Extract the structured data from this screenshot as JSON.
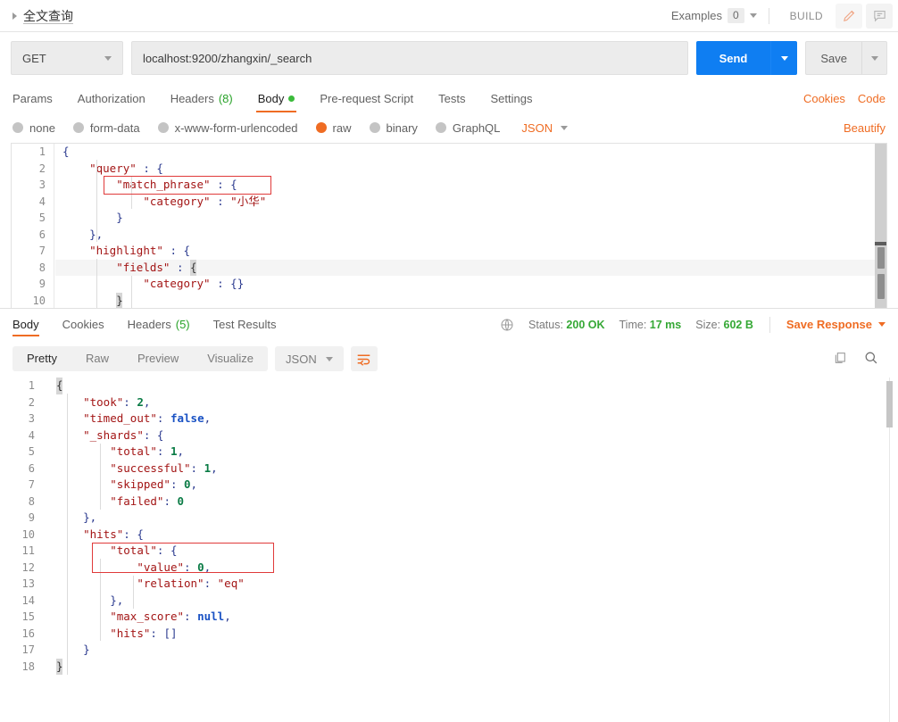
{
  "titlebar": {
    "breadcrumb": "全文查询",
    "examples_label": "Examples",
    "examples_count": "0",
    "build_label": "BUILD",
    "edit_icon": "pencil-icon",
    "comment_icon": "comment-icon"
  },
  "urlbar": {
    "method": "GET",
    "url": "localhost:9200/zhangxin/_search",
    "send_label": "Send",
    "save_label": "Save"
  },
  "request_tabs": {
    "items": [
      {
        "label": "Params",
        "count": "",
        "active": false,
        "dot": false
      },
      {
        "label": "Authorization",
        "count": "",
        "active": false,
        "dot": false
      },
      {
        "label": "Headers",
        "count": "(8)",
        "active": false,
        "dot": false
      },
      {
        "label": "Body",
        "count": "",
        "active": true,
        "dot": true
      },
      {
        "label": "Pre-request Script",
        "count": "",
        "active": false,
        "dot": false
      },
      {
        "label": "Tests",
        "count": "",
        "active": false,
        "dot": false
      },
      {
        "label": "Settings",
        "count": "",
        "active": false,
        "dot": false
      }
    ],
    "cookies_label": "Cookies",
    "code_label": "Code"
  },
  "body_row": {
    "options": [
      {
        "label": "none",
        "selected": false
      },
      {
        "label": "form-data",
        "selected": false
      },
      {
        "label": "x-www-form-urlencoded",
        "selected": false
      },
      {
        "label": "raw",
        "selected": true
      },
      {
        "label": "binary",
        "selected": false
      },
      {
        "label": "GraphQL",
        "selected": false
      }
    ],
    "format": "JSON",
    "beautify_label": "Beautify"
  },
  "request_body": {
    "lines": [
      {
        "n": "1",
        "text": "{"
      },
      {
        "n": "2",
        "text": "    \"query\" : {"
      },
      {
        "n": "3",
        "text": "        \"match_phrase\" : {"
      },
      {
        "n": "4",
        "text": "            \"category\" : \"小华\""
      },
      {
        "n": "5",
        "text": "        }"
      },
      {
        "n": "6",
        "text": "    },"
      },
      {
        "n": "7",
        "text": "    \"highlight\" : {"
      },
      {
        "n": "8",
        "text": "        \"fields\" : {"
      },
      {
        "n": "9",
        "text": "            \"category\" : {}"
      },
      {
        "n": "10",
        "text": "        }"
      }
    ],
    "highlight_note": "red annotation box around line 3 match_phrase"
  },
  "response_tabs": {
    "items": [
      {
        "label": "Body",
        "count": "",
        "active": true
      },
      {
        "label": "Cookies",
        "count": "",
        "active": false
      },
      {
        "label": "Headers",
        "count": "(5)",
        "active": false
      },
      {
        "label": "Test Results",
        "count": "",
        "active": false
      }
    ],
    "status_label": "Status:",
    "status_value": "200 OK",
    "time_label": "Time:",
    "time_value": "17 ms",
    "size_label": "Size:",
    "size_value": "602 B",
    "save_response_label": "Save Response",
    "globe_icon": "globe-icon"
  },
  "response_toolbar": {
    "views": [
      {
        "label": "Pretty",
        "active": true
      },
      {
        "label": "Raw",
        "active": false
      },
      {
        "label": "Preview",
        "active": false
      },
      {
        "label": "Visualize",
        "active": false
      }
    ],
    "format": "JSON",
    "wrap_icon": "word-wrap-icon",
    "copy_icon": "copy-icon",
    "search_icon": "search-icon"
  },
  "response_body": {
    "lines": [
      {
        "n": "1",
        "text": "{"
      },
      {
        "n": "2",
        "text": "    \"took\": 2,"
      },
      {
        "n": "3",
        "text": "    \"timed_out\": false,"
      },
      {
        "n": "4",
        "text": "    \"_shards\": {"
      },
      {
        "n": "5",
        "text": "        \"total\": 1,"
      },
      {
        "n": "6",
        "text": "        \"successful\": 1,"
      },
      {
        "n": "7",
        "text": "        \"skipped\": 0,"
      },
      {
        "n": "8",
        "text": "        \"failed\": 0"
      },
      {
        "n": "9",
        "text": "    },"
      },
      {
        "n": "10",
        "text": "    \"hits\": {"
      },
      {
        "n": "11",
        "text": "        \"total\": {"
      },
      {
        "n": "12",
        "text": "            \"value\": 0,"
      },
      {
        "n": "13",
        "text": "            \"relation\": \"eq\""
      },
      {
        "n": "14",
        "text": "        },"
      },
      {
        "n": "15",
        "text": "        \"max_score\": null,"
      },
      {
        "n": "16",
        "text": "        \"hits\": []"
      },
      {
        "n": "17",
        "text": "    }"
      },
      {
        "n": "18",
        "text": "}"
      }
    ],
    "highlight_note": "red annotation box around lines 11-12 total/value"
  },
  "colors": {
    "accent_orange": "#ef6c23",
    "send_blue": "#0f7ef2",
    "status_green": "#35a835",
    "annotation_red": "#e03a3a"
  }
}
